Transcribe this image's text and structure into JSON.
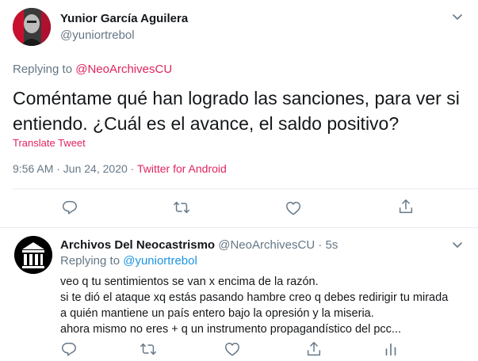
{
  "main_tweet": {
    "author_name": "Yunior García Aguilera",
    "author_handle": "@yuniortrebol",
    "replying_prefix": "Replying to ",
    "replying_to": "@NeoArchivesCU",
    "text": "Coméntame qué han logrado las sanciones, para ver si entiendo. ¿Cuál es el avance, el saldo positivo?",
    "translate_label": "Translate Tweet",
    "timestamp": "9:56 AM · Jun 24, 2020",
    "separator": " · ",
    "source": "Twitter for Android"
  },
  "reply_tweet": {
    "author_name": "Archivos Del Neocastrismo",
    "author_handle": "@NeoArchivesCU",
    "age": " · 5s",
    "replying_prefix": "Replying to ",
    "replying_to": "@yuniortrebol",
    "lines": [
      "veo q tu sentimientos se van x encima de la razón.",
      "si te dió el ataque xq estás pasando hambre creo q debes redirigir tu mirada",
      "a quién mantiene un país entero bajo la opresión y la miseria.",
      "ahora mismo no eres + q un instrumento propagandístico del pcc..."
    ]
  },
  "icons": {
    "reply": "reply-icon",
    "retweet": "retweet-icon",
    "like": "heart-icon",
    "share": "share-icon",
    "more": "chevron-down-icon"
  },
  "colors": {
    "accent": "#e0245e",
    "secondary_text": "#657786",
    "icon": "#657786",
    "divider": "#e6ecf0"
  }
}
